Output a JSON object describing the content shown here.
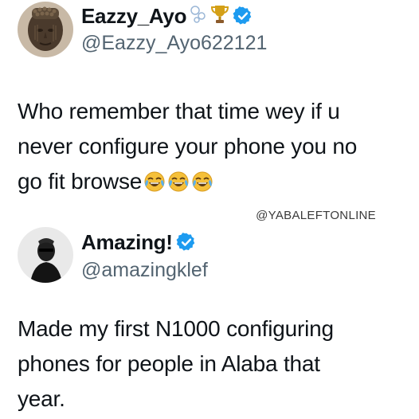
{
  "tweets": [
    {
      "display_name": "Eazzy_Ayo",
      "handle": "@Eazzy_Ayo622121",
      "name_icons": [
        "bubbles-icon",
        "trophy-icon",
        "verified-badge-icon"
      ],
      "text": "Who remember that time wey if u\nnever configure your phone you no\ngo fit browse",
      "trailing_emojis": [
        "face-with-tears-of-joy-icon",
        "face-with-tears-of-joy-icon",
        "face-with-tears-of-joy-icon"
      ]
    },
    {
      "display_name": "Amazing!",
      "handle": "@amazingklef",
      "name_icons": [
        "verified-badge-icon"
      ],
      "text": "Made my first N1000 configuring\nphones for people in Alaba that\nyear."
    }
  ],
  "watermark": "@YABALEFTONLINE",
  "colors": {
    "text": "#0f1419",
    "handle": "#536471",
    "verified": "#1d9bf0",
    "trophy": "#d4a017"
  }
}
